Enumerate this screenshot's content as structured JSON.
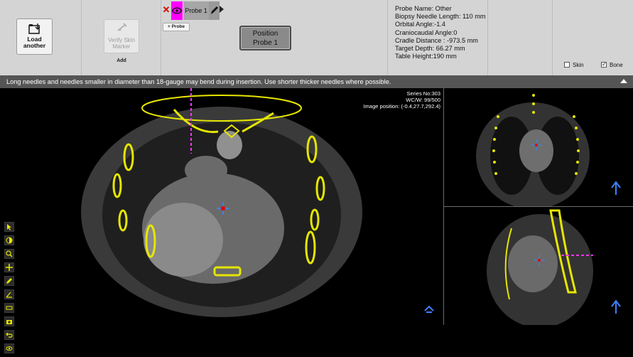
{
  "toolbar": {
    "load_label_1": "Load",
    "load_label_2": "another",
    "verify_label_1": "Verify Skin",
    "verify_label_2": "Marker",
    "add_label": "Add",
    "probe_tab_label": "Probe 1",
    "add_probe_label": "+ Probe",
    "position_label_1": "Position",
    "position_label_2": "Probe 1"
  },
  "probe_info": {
    "name": "Probe Name: Other",
    "needle_length": "Biopsy Needle Length: 110 mm",
    "orbital_angle": "Orbital Angle:-1.4",
    "craniocaudal_angle": "Craniocaudal Angle:0",
    "cradle_distance": "Cradle Distance : -973.5 mm",
    "target_depth": "Target Depth: 66.27 mm",
    "table_height": "Table Height:190 mm"
  },
  "display_options": {
    "skin_label": "Skin",
    "skin_checked": false,
    "bone_label": "Bone",
    "bone_checked": true
  },
  "banner": {
    "message": "Long needles and needles smaller in diameter than 18-gauge may bend during insertion. Use shorter thicker needles where possible."
  },
  "main_view": {
    "series": "Series No:303",
    "wcw": "WC/W: 99/500",
    "image_position": "Image position: (-0.4,27.7,292.4)"
  },
  "tools": [
    "pointer-icon",
    "contrast-icon",
    "zoom-icon",
    "pan-icon",
    "pencil-icon",
    "angle-icon",
    "ruler-icon",
    "camera-icon",
    "undo-icon",
    "eye-icon"
  ],
  "colors": {
    "toolbar_bg": "#d4d4d4",
    "banner_bg": "#555555",
    "probe_highlight": "#ff00ff",
    "bone_overlay": "#e6e600",
    "needle_line": "#ff33ff"
  }
}
